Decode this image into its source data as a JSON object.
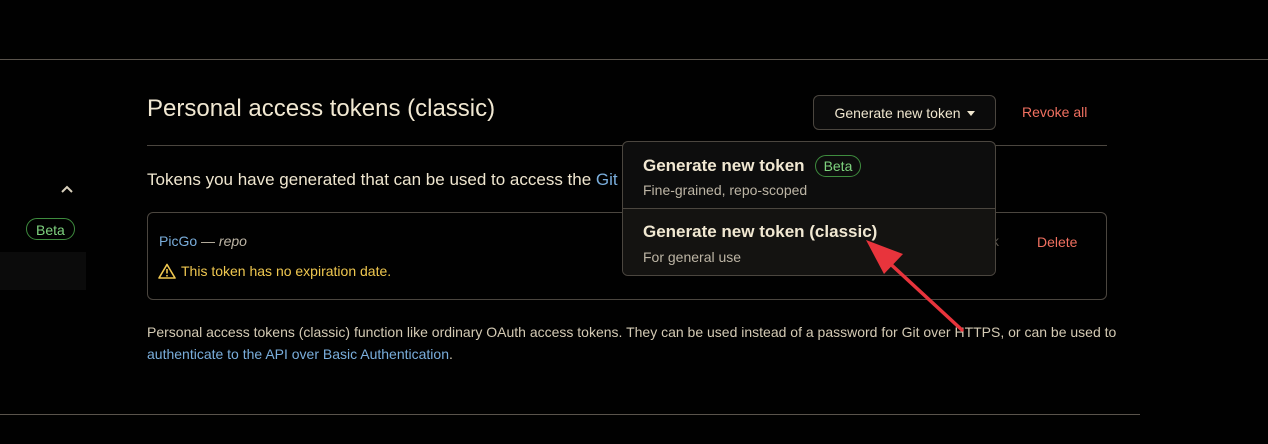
{
  "header": {
    "title": "Personal access tokens (classic)",
    "generate_button_label": "Generate new token",
    "revoke_all_label": "Revoke all"
  },
  "sidebar": {
    "beta_badge": "Beta"
  },
  "intro": {
    "text": "Tokens you have generated that can be used to access the ",
    "link_partial": "Git"
  },
  "token": {
    "name": "PicGo",
    "separator": " — ",
    "scope": "repo",
    "warning": "This token has no expiration date.",
    "partial_text": "k",
    "delete_label": "Delete"
  },
  "dropdown": {
    "items": [
      {
        "title": "Generate new token",
        "badge": "Beta",
        "description": "Fine-grained, repo-scoped"
      },
      {
        "title": "Generate new token (classic)",
        "description": "For general use"
      }
    ]
  },
  "footer": {
    "text_before_link": "Personal access tokens (classic) function like ordinary OAuth access tokens. They can be used instead of a password for Git over HTTPS, or can be used to ",
    "link": "authenticate to the API over Basic Authentication",
    "text_after_link": "."
  },
  "colors": {
    "background": "#010101",
    "link": "#7aaedc",
    "danger": "#f07060",
    "warning": "#f0c850",
    "beta": "#7fd37f",
    "annotation_arrow": "#e8343c"
  },
  "icons": [
    "chevron-up-icon",
    "warning-icon",
    "caret-down-icon",
    "annotation-arrow-icon"
  ]
}
